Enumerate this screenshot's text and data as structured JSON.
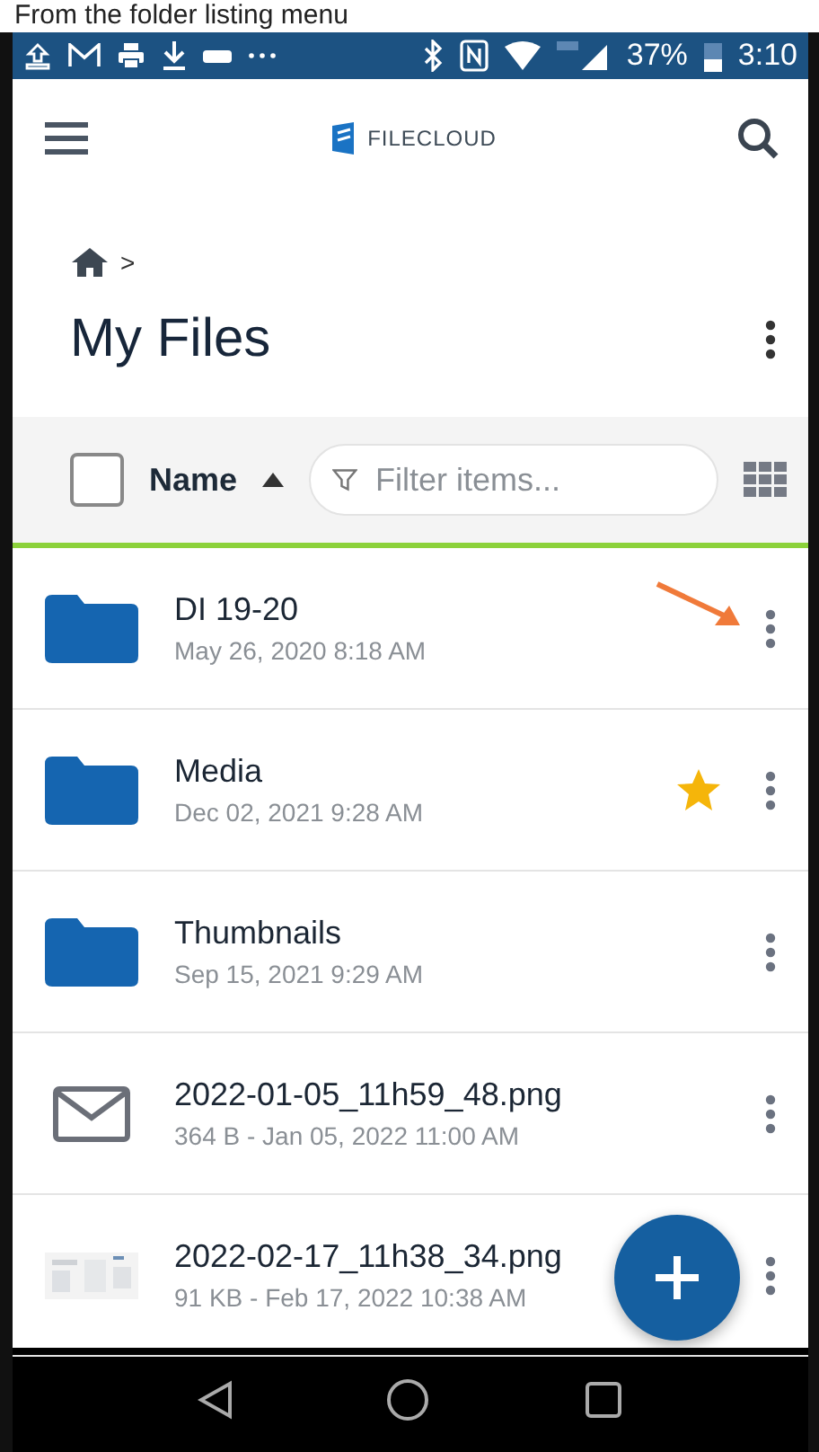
{
  "caption": "From the folder listing menu",
  "status_bar": {
    "battery": "37%",
    "time": "3:10"
  },
  "header": {
    "logo": "FILECLOUD"
  },
  "breadcrumb": {
    "separator": ">"
  },
  "title": "My Files",
  "toolbar": {
    "select_all_checked": false,
    "sort_label": "Name",
    "sort_ascending": true,
    "filter": {
      "placeholder": "Filter items..."
    }
  },
  "items": [
    {
      "kind": "folder",
      "name": "DI 19-20",
      "meta": "May 26, 2020 8:18 AM",
      "starred": false,
      "pointed": true
    },
    {
      "kind": "folder",
      "name": "Media",
      "meta": "Dec 02, 2021 9:28 AM",
      "starred": true,
      "pointed": false
    },
    {
      "kind": "folder",
      "name": "Thumbnails",
      "meta": "Sep 15, 2021 9:29 AM",
      "starred": false,
      "pointed": false
    },
    {
      "kind": "mail-image",
      "name": "2022-01-05_11h59_48.png",
      "meta": "364 B - Jan 05, 2022 11:00 AM",
      "starred": false,
      "pointed": false
    },
    {
      "kind": "screenshot-image",
      "name": "2022-02-17_11h38_34.png",
      "meta": "91 KB - Feb 17, 2022 10:38 AM",
      "starred": false,
      "pointed": false
    }
  ]
}
